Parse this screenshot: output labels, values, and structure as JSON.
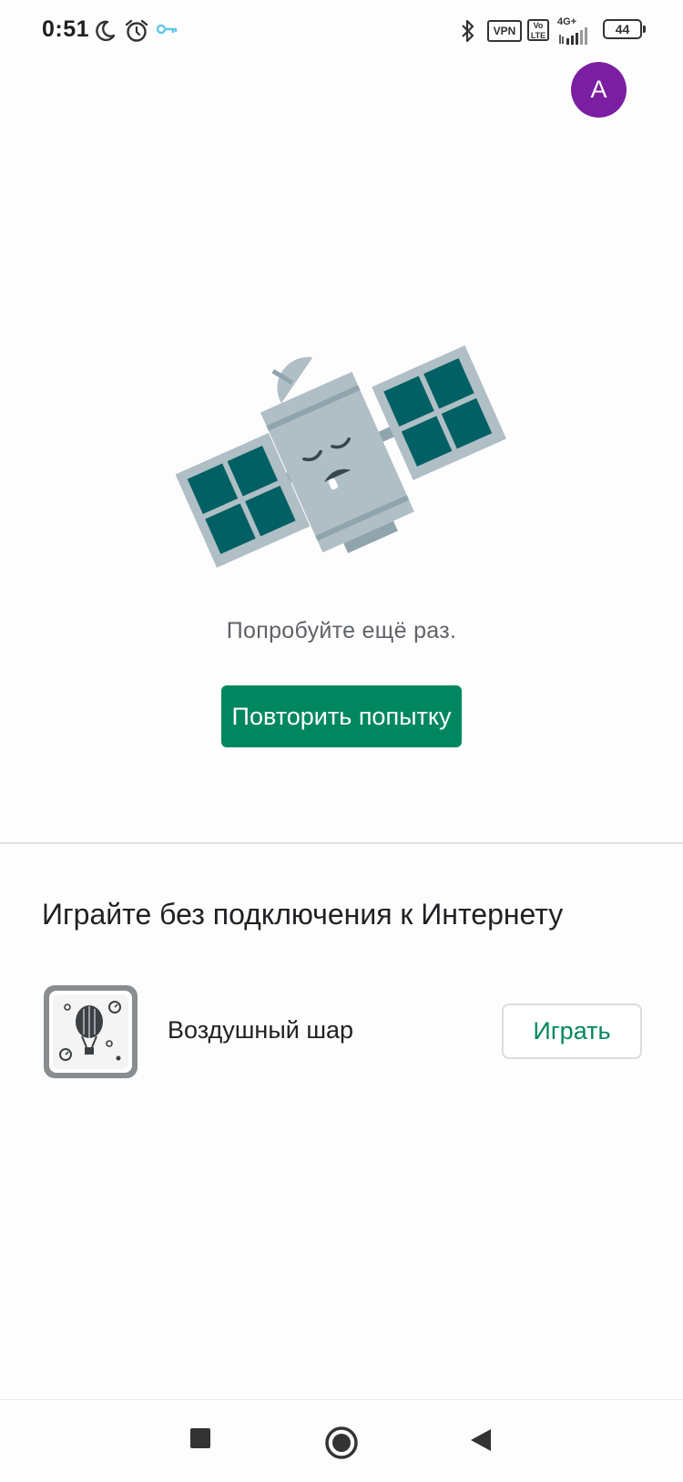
{
  "status_bar": {
    "time": "0:51",
    "vpn_label": "VPN",
    "volte_label": "Vo LTE",
    "network_label": "4G+",
    "battery_level": "44",
    "icons": [
      "moon-icon",
      "alarm-icon",
      "vpn-key-icon",
      "bluetooth-icon",
      "signal-icon"
    ]
  },
  "account": {
    "avatar_letter": "A",
    "avatar_color": "#7b1fa2"
  },
  "error_state": {
    "message": "Попробуйте ещё раз.",
    "retry_label": "Повторить попытку",
    "accent_color": "#01875f"
  },
  "offline_games": {
    "title": "Играйте без подключения к Интернету",
    "items": [
      {
        "name": "Воздушный шар",
        "action_label": "Играть",
        "icon": "balloon-game-icon"
      }
    ]
  },
  "nav_bar": {
    "buttons": [
      "recents-button",
      "home-button",
      "back-button"
    ]
  }
}
